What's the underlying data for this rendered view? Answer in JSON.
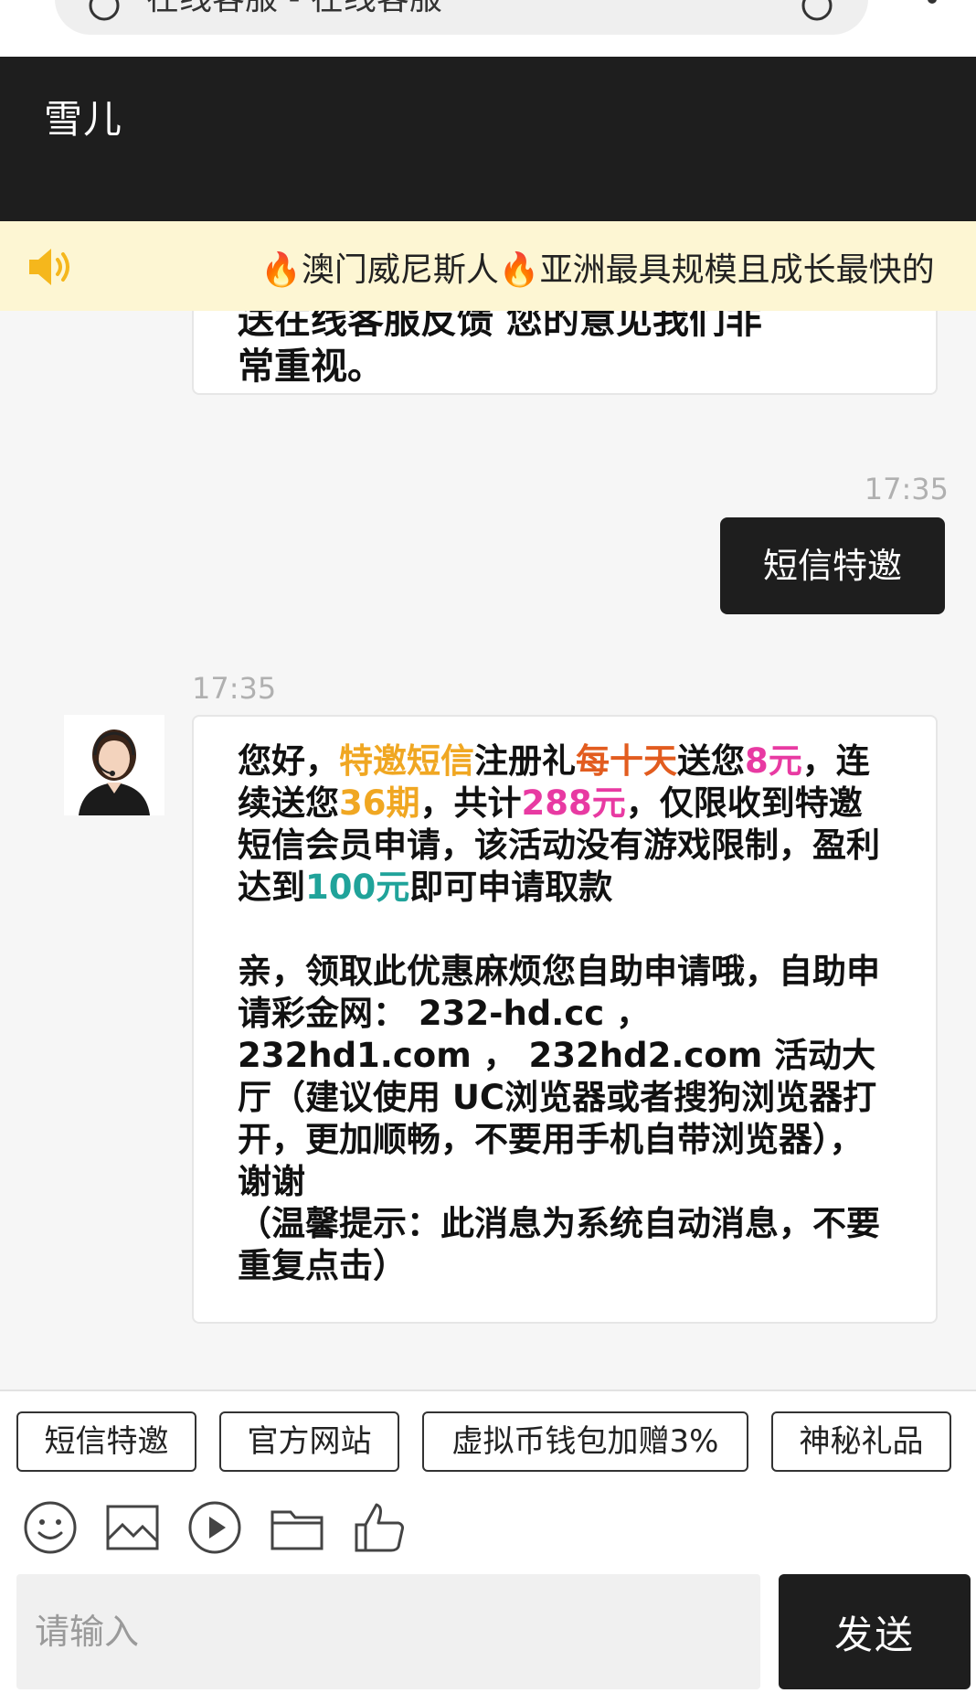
{
  "browser": {
    "url_text": "在线客服 - 在线客服"
  },
  "header": {
    "title": "雪儿"
  },
  "notice": {
    "text": "🔥澳门威尼斯人🔥亚洲最具规模且成长最快的"
  },
  "messages": {
    "cut_bubble_line1": "送在线客服反馈 您的意见我们非",
    "cut_bubble_line2": "常重视。",
    "outgoing_time": "17:35",
    "outgoing_text": "短信特邀",
    "incoming_time": "17:35",
    "main": {
      "p1_a": "您好，",
      "p1_b": "特邀短信",
      "p1_c": "注册礼",
      "p1_d": "每十天",
      "p1_e": "送您",
      "p1_f": "8元",
      "p1_g": "，连续送您",
      "p1_h": "36期",
      "p1_i": "，共计",
      "p1_j": "288元",
      "p1_k": "，仅限收到特邀短信会员申请，该活动没有游戏限制，盈利达到",
      "p1_l": "100元",
      "p1_m": "即可申请取款",
      "p2": "亲，领取此优惠麻烦您自助申请哦，自助申请彩金网： 232-hd.cc ， 232hd1.com ， 232hd2.com 活动大厅（建议使用 UC浏览器或者搜狗浏览器打开，更加顺畅，不要用手机自带浏览器），谢谢",
      "p3": "（温馨提示：此消息为系统自动消息，不要重复点击）"
    }
  },
  "quick_buttons": [
    "短信特邀",
    "官方网站",
    "虚拟币钱包加赠3%",
    "神秘礼品"
  ],
  "toolbar": {
    "icons": [
      "smiley-icon",
      "image-icon",
      "video-play-icon",
      "folder-icon",
      "thumbs-up-icon"
    ]
  },
  "composer": {
    "placeholder": "请输入",
    "send_label": "发送"
  }
}
